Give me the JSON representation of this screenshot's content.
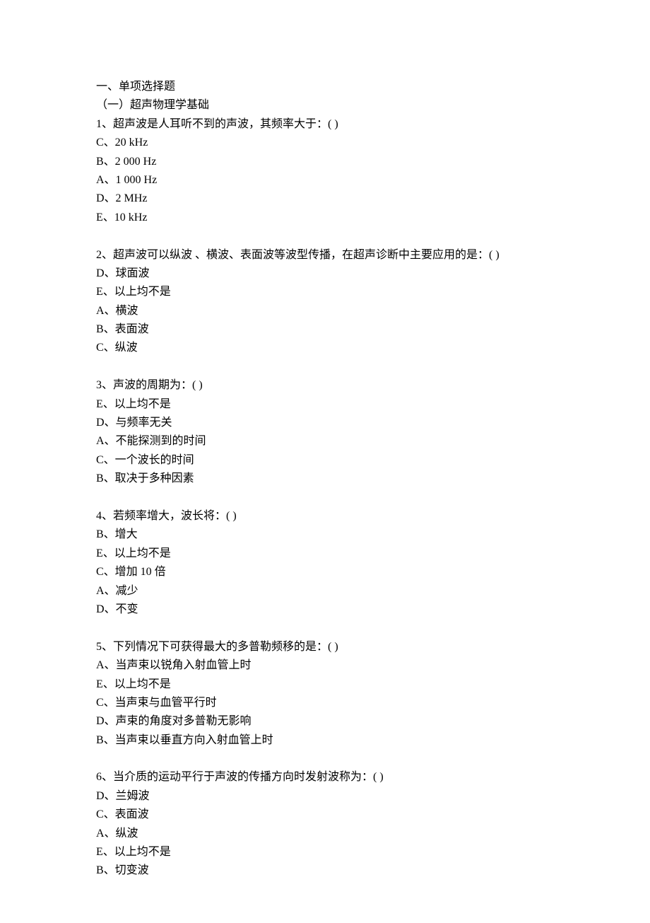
{
  "section_heading": "一、单项选择题",
  "subheading": "（一）超声物理学基础",
  "questions": [
    {
      "stem": "1、超声波是人耳听不到的声波，其频率大于：( )",
      "options": [
        "C、20 kHz",
        "B、2 000 Hz",
        "A、1 000 Hz",
        "D、2 MHz",
        "E、10 kHz"
      ]
    },
    {
      "stem": "2、超声波可以纵波 、横波、表面波等波型传播，在超声诊断中主要应用的是：( )",
      "options": [
        "D、球面波",
        "E、以上均不是",
        "A、横波",
        "B、表面波",
        "C、纵波"
      ]
    },
    {
      "stem": "3、声波的周期为：( )",
      "options": [
        "E、以上均不是",
        "D、与频率无关",
        "A、不能探测到的时间",
        "C、一个波长的时间",
        "B、取决于多种因素"
      ]
    },
    {
      "stem": "4、若频率增大，波长将：( )",
      "options": [
        "B、增大",
        "E、以上均不是",
        "C、增加 10 倍",
        "A、减少",
        "D、不变"
      ]
    },
    {
      "stem": "5、下列情况下可获得最大的多普勒频移的是：( )",
      "options": [
        "A、当声束以锐角入射血管上时",
        "E、以上均不是",
        "C、当声束与血管平行时",
        "D、声束的角度对多普勒无影响",
        "B、当声束以垂直方向入射血管上时"
      ]
    },
    {
      "stem": "6、当介质的运动平行于声波的传播方向时发射波称为：( )",
      "options": [
        "D、兰姆波",
        "C、表面波",
        "A、纵波",
        "E、以上均不是",
        "B、切变波"
      ]
    }
  ]
}
